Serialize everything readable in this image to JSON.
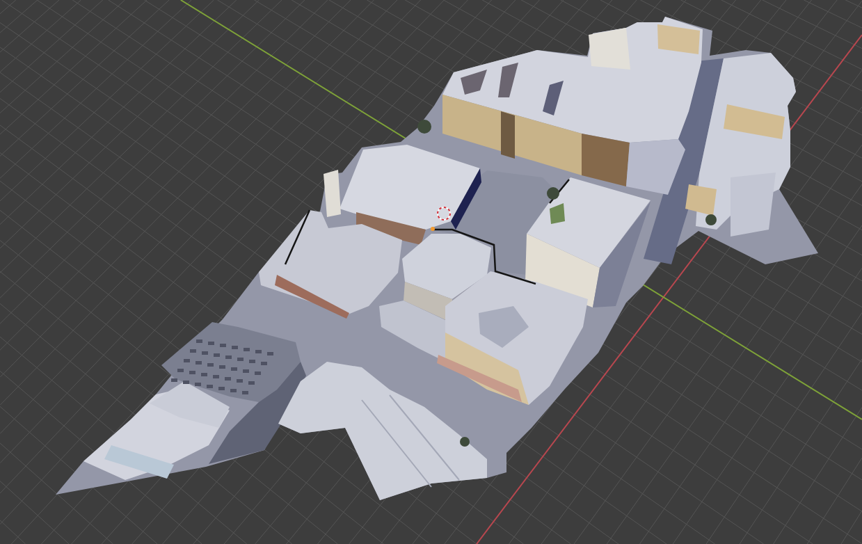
{
  "viewport": {
    "axes": [
      {
        "kind": "x",
        "color": "#b8474f"
      },
      {
        "kind": "y",
        "color": "#7ea238"
      }
    ],
    "objects": [
      {
        "kind": "mesh"
      },
      {
        "kind": "cursor"
      },
      {
        "kind": "origin"
      }
    ]
  }
}
